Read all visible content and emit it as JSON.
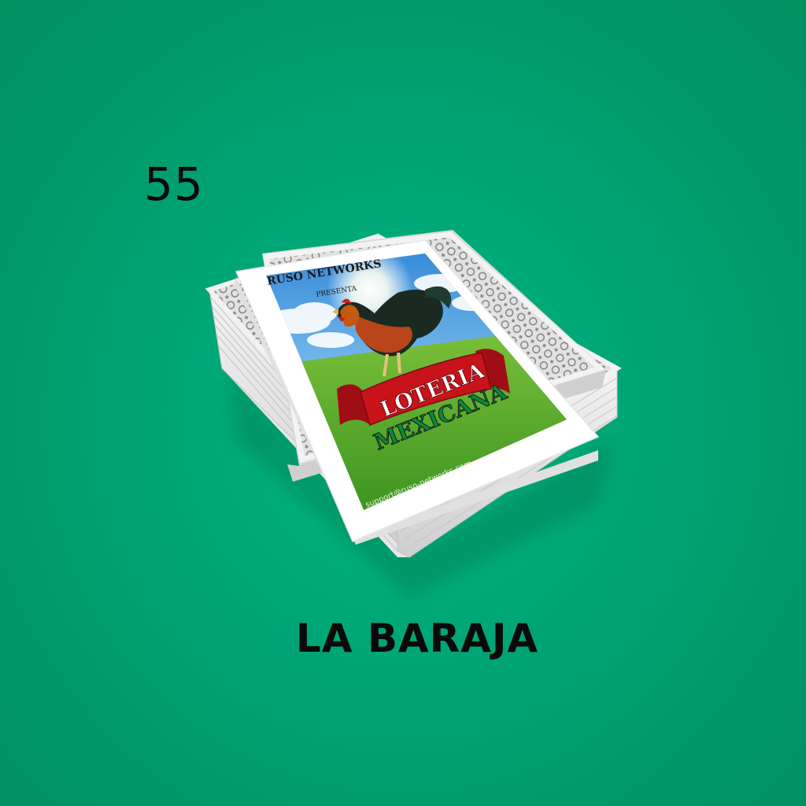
{
  "card": {
    "number": "55",
    "name": "LA BARAJA"
  },
  "deck_card_face": {
    "publisher": "RUSO NETWORKS",
    "presents": "PRESENTA",
    "title_line_1": "LOTERIA",
    "title_line_2": "MEXICANA",
    "email": "support@ruso-networks.com"
  },
  "colors": {
    "background": "#00a676",
    "ribbon_red": "#c8131b",
    "flag_green": "#0a8a3a",
    "flag_white": "#ffffff",
    "flag_red": "#d0101a"
  }
}
